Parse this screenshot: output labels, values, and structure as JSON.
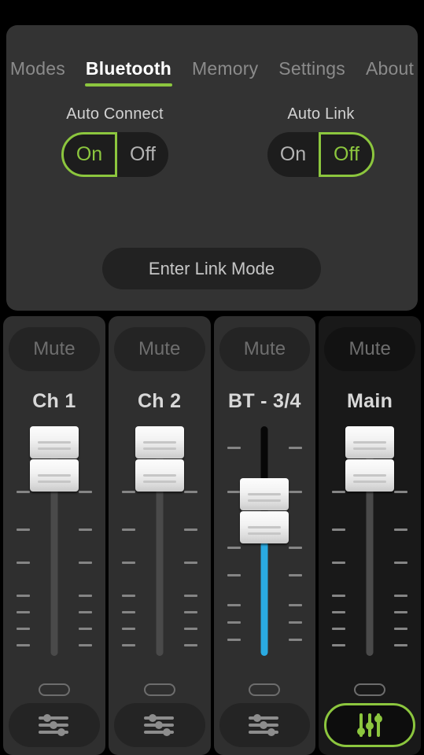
{
  "app": {
    "accent_green": "#8cc63e",
    "accent_blue": "#2aaae1",
    "background": "#000000"
  },
  "settings_panel": {
    "tabs": [
      {
        "label": "Modes",
        "active": false
      },
      {
        "label": "Bluetooth",
        "active": true
      },
      {
        "label": "Memory",
        "active": false
      },
      {
        "label": "Settings",
        "active": false
      },
      {
        "label": "About",
        "active": false
      }
    ],
    "toggles": [
      {
        "name": "auto-connect",
        "label": "Auto Connect",
        "on_label": "On",
        "off_label": "Off",
        "selected": "On"
      },
      {
        "name": "auto-link",
        "label": "Auto Link",
        "on_label": "On",
        "off_label": "Off",
        "selected": "Off"
      }
    ],
    "link_mode_button": "Enter Link Mode"
  },
  "mixer": {
    "channels": [
      {
        "name": "Ch 1",
        "mute_label": "Mute",
        "muted": false,
        "selected": false,
        "fader_level_pct": 88,
        "fader_color": "#4a4a4a",
        "icon": "horizontal-sliders-icon"
      },
      {
        "name": "Ch 2",
        "mute_label": "Mute",
        "muted": false,
        "selected": false,
        "fader_level_pct": 88,
        "fader_color": "#4a4a4a",
        "icon": "horizontal-sliders-icon"
      },
      {
        "name": "BT - 3/4",
        "mute_label": "Mute",
        "muted": false,
        "selected": false,
        "fader_level_pct": 69,
        "fader_color": "#2aaae1",
        "icon": "horizontal-sliders-icon"
      },
      {
        "name": "Main",
        "mute_label": "Mute",
        "muted": false,
        "selected": true,
        "fader_level_pct": 88,
        "fader_color": "#4a4a4a",
        "icon": "vertical-sliders-icon"
      }
    ],
    "tick_positions_pct": [
      28,
      44,
      58,
      72,
      79,
      86,
      93
    ]
  }
}
